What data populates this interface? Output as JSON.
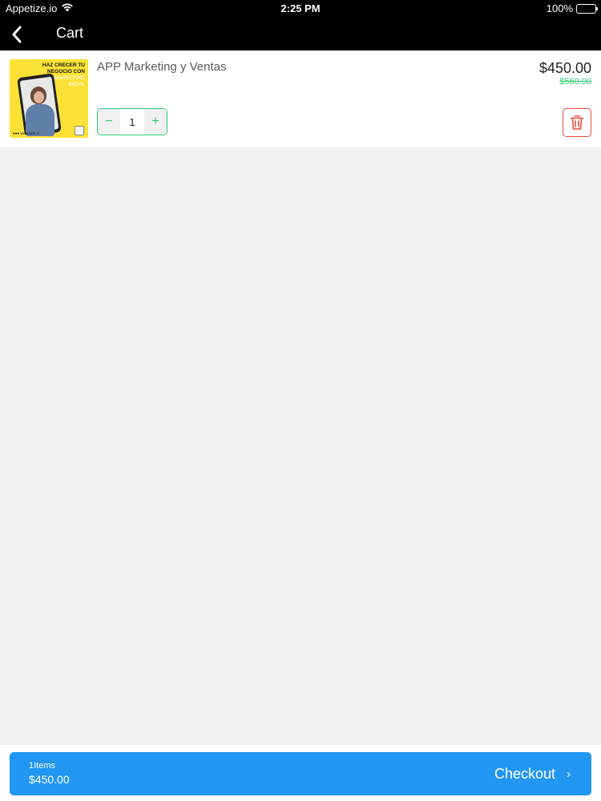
{
  "status_bar": {
    "carrier": "Appetize.io",
    "time": "2:25 PM",
    "battery": "100%"
  },
  "nav": {
    "title": "Cart"
  },
  "cart": {
    "items": [
      {
        "name": "APP Marketing y Ventas",
        "price": "$450.00",
        "old_price": "$560.00",
        "quantity": "1",
        "thumbnail": {
          "headline_line1": "HAZ CRECER TU",
          "headline_line2": "NEGOCIO CON",
          "headline_line3": "MARKETING",
          "headline_line4": "MÓVIL",
          "footer": "●●● www.web.cl"
        }
      }
    ]
  },
  "stepper": {
    "minus": "−",
    "plus": "+"
  },
  "checkout": {
    "items_count": "1Items",
    "total": "$450.00",
    "label": "Checkout",
    "chevron": "›"
  },
  "colors": {
    "accent_green": "#2ecc71",
    "delete_red": "#e74c3c",
    "checkout_blue": "#2196f3"
  }
}
